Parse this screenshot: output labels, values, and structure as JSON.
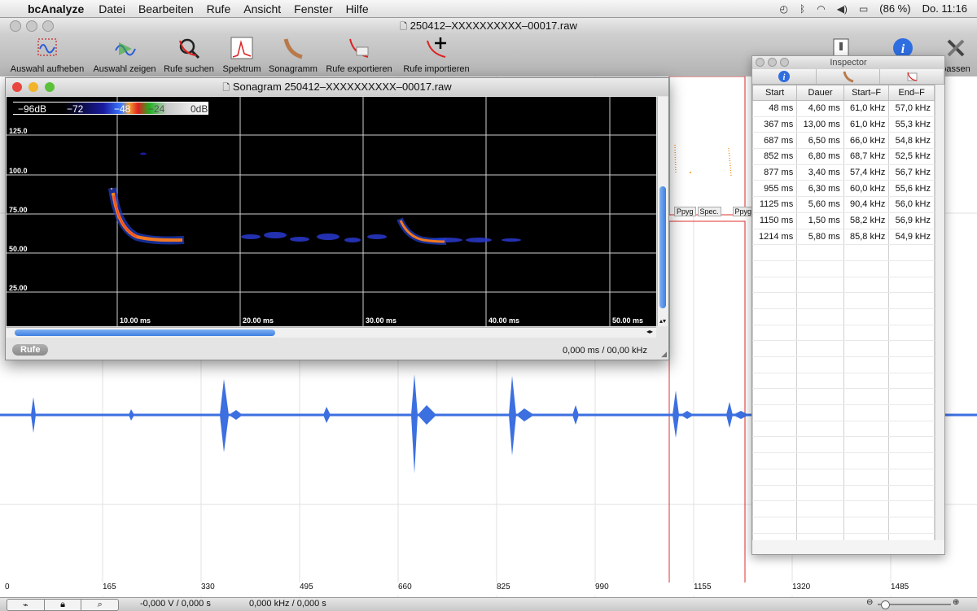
{
  "menubar": {
    "app_name": "bcAnalyze",
    "menus": [
      "Datei",
      "Bearbeiten",
      "Rufe",
      "Ansicht",
      "Fenster",
      "Hilfe"
    ],
    "battery": "(86 %)",
    "clock": "Do. 11:16"
  },
  "main_window": {
    "title": "250412–XXXXXXXXXX–00017.raw",
    "toolbar": [
      {
        "label": "Auswahl aufheben",
        "icon": "deselect-icon"
      },
      {
        "label": "Auswahl zeigen",
        "icon": "show-selection-icon"
      },
      {
        "label": "Rufe suchen",
        "icon": "search-calls-icon"
      },
      {
        "label": "Spektrum",
        "icon": "spectrum-icon"
      },
      {
        "label": "Sonagramm",
        "icon": "sonagram-icon"
      },
      {
        "label": "Rufe exportieren",
        "icon": "export-calls-icon"
      },
      {
        "label": "Rufe importieren",
        "icon": "import-calls-icon"
      }
    ],
    "toolbar_right_label": "passen",
    "side_labels": [
      "Ppyg",
      "Spec.",
      "Ppyg"
    ],
    "axis_ticks": [
      "0",
      "165",
      "330",
      "495",
      "660",
      "825",
      "990",
      "1155",
      "1320",
      "1485"
    ],
    "status_left": "-0,000 V /  0,000 s",
    "status_mid": "0,000  kHz / 0,000 s"
  },
  "sonagram": {
    "title": "Sonagram 250412–XXXXXXXXXX–00017.raw",
    "legend": [
      "−96dB",
      "−72",
      "−48",
      "−24",
      "0dB"
    ],
    "freq_labels": [
      "125.0",
      "100.0",
      "75.00",
      "50.00",
      "25.00"
    ],
    "time_labels": [
      "10.00 ms",
      "20.00 ms",
      "30.00 ms",
      "40.00 ms",
      "50.00 ms"
    ],
    "rufe_button": "Rufe",
    "status": "0,000 ms /  00,00 kHz"
  },
  "inspector": {
    "title": "Inspector",
    "columns": [
      "Start",
      "Dauer",
      "Start–F",
      "End–F"
    ],
    "rows": [
      [
        "48 ms",
        "4,60 ms",
        "61,0 kHz",
        "57,0 kHz"
      ],
      [
        "367 ms",
        "13,00 ms",
        "61,0 kHz",
        "55,3 kHz"
      ],
      [
        "687 ms",
        "6,50 ms",
        "66,0 kHz",
        "54,8 kHz"
      ],
      [
        "852 ms",
        "6,80 ms",
        "68,7 kHz",
        "52,5 kHz"
      ],
      [
        "877 ms",
        "3,40 ms",
        "57,4 kHz",
        "56,7 kHz"
      ],
      [
        "955 ms",
        "6,30 ms",
        "60,0 kHz",
        "55,6 kHz"
      ],
      [
        "1125 ms",
        "5,60 ms",
        "90,4 kHz",
        "56,0 kHz"
      ],
      [
        "1150 ms",
        "1,50 ms",
        "58,2 kHz",
        "56,9 kHz"
      ],
      [
        "1214 ms",
        "5,80 ms",
        "85,8 kHz",
        "54,9 kHz"
      ]
    ]
  }
}
